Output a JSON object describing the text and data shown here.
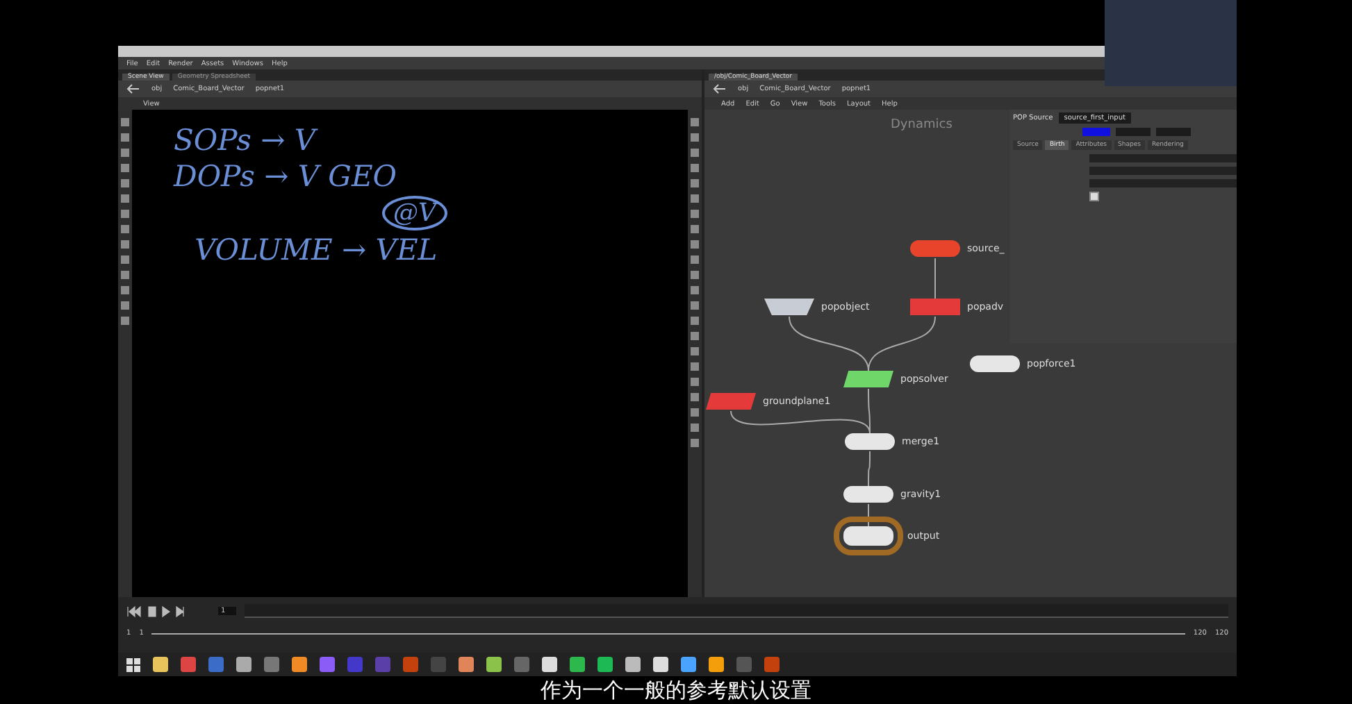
{
  "menu": [
    "File",
    "Edit",
    "Render",
    "Assets",
    "Windows",
    "Help"
  ],
  "left_pane": {
    "tabs": [
      {
        "label": "Scene View",
        "selected": true
      },
      {
        "label": "Geometry Spreadsheet",
        "selected": false
      }
    ],
    "path": [
      "obj",
      "Comic_Board_Vector",
      "popnet1"
    ],
    "viewer_label": "View",
    "sketch": [
      {
        "text": "SOPs → V"
      },
      {
        "text": "DOPs → V GEO"
      },
      {
        "text": "@V"
      },
      {
        "text": "VOLUME → VEL"
      }
    ]
  },
  "right_pane": {
    "tabs": [
      {
        "label": "/obj/Comic_Board_Vector",
        "selected": true
      }
    ],
    "path": [
      "obj",
      "Comic_Board_Vector",
      "popnet1"
    ],
    "menu": [
      "Add",
      "Edit",
      "Go",
      "View",
      "Tools",
      "Layout",
      "Help"
    ],
    "context_label": "Dynamics",
    "nodes": [
      {
        "name": "source_",
        "kind": "pill",
        "color": "#e8442c"
      },
      {
        "name": "popadv",
        "kind": "rect",
        "color": "#e43a3a"
      },
      {
        "name": "popobject",
        "kind": "trap",
        "color": "#c8ccd4"
      },
      {
        "name": "popsolver",
        "kind": "para",
        "color": "#6fd66a"
      },
      {
        "name": "popforce1",
        "kind": "pill",
        "color": "#e6e6e6"
      },
      {
        "name": "groundplane1",
        "kind": "para",
        "color": "#e43a3a"
      },
      {
        "name": "merge1",
        "kind": "pill",
        "color": "#e6e6e6"
      },
      {
        "name": "gravity1",
        "kind": "pill",
        "color": "#e6e6e6"
      },
      {
        "name": "output",
        "kind": "ring",
        "color": "#e6e6e6"
      }
    ],
    "parameters": {
      "node_type": "POP Source",
      "node_name": "source_first_input",
      "tabs": [
        {
          "label": "Source",
          "selected": false
        },
        {
          "label": "Birth",
          "selected": true
        },
        {
          "label": "Attributes",
          "selected": false
        },
        {
          "label": "Shapes",
          "selected": false
        },
        {
          "label": "Rendering",
          "selected": false
        }
      ],
      "checkbox": {
        "checked": true
      }
    }
  },
  "timeline": {
    "frame": "1",
    "start": "1",
    "range_start": "1",
    "range_end": "120",
    "end": "120"
  },
  "subtitle": "作为一个一般的参考默认设置"
}
